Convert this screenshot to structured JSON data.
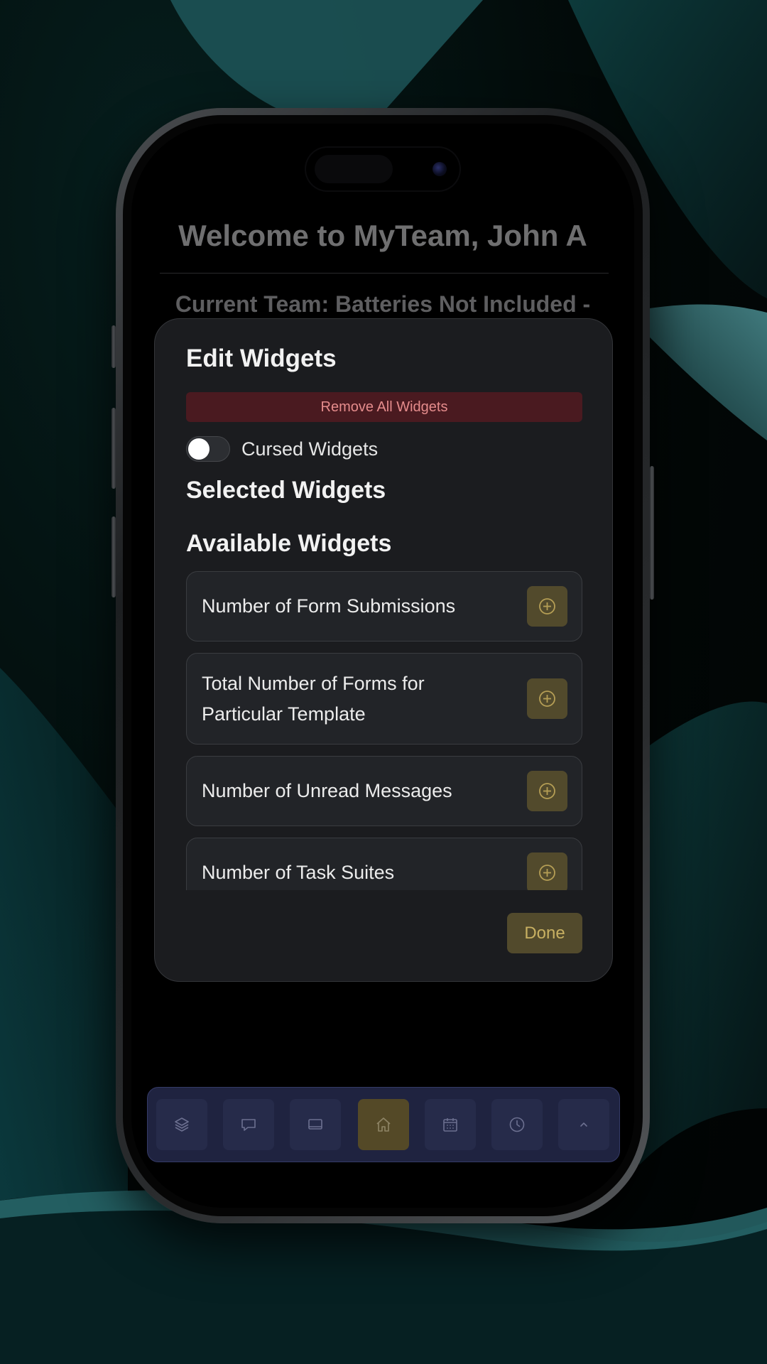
{
  "page": {
    "title": "Welcome to MyTeam, John A",
    "current_team": "Current Team: Batteries Not Included -"
  },
  "modal": {
    "title": "Edit Widgets",
    "remove_all_label": "Remove All Widgets",
    "cursed_toggle": {
      "label": "Cursed Widgets",
      "on": false
    },
    "selected_heading": "Selected Widgets",
    "available_heading": "Available Widgets",
    "available_widgets": [
      {
        "label": "Number of Form Submissions",
        "action_icon": "plus-circle-icon"
      },
      {
        "label": "Total Number of Forms for Particular Template",
        "action_icon": "plus-circle-icon"
      },
      {
        "label": "Number of Unread Messages",
        "action_icon": "plus-circle-icon"
      },
      {
        "label": "Number of Task Suites",
        "action_icon": "plus-circle-icon"
      }
    ],
    "done_label": "Done"
  },
  "nav": {
    "items": [
      {
        "icon": "layers-icon",
        "active": false
      },
      {
        "icon": "chat-icon",
        "active": false
      },
      {
        "icon": "tablet-icon",
        "active": false
      },
      {
        "icon": "home-icon",
        "active": true
      },
      {
        "icon": "calendar-icon",
        "active": false
      },
      {
        "icon": "clock-icon",
        "active": false
      },
      {
        "icon": "chevron-up-icon",
        "active": false
      }
    ]
  },
  "colors": {
    "accent": "#524a2c",
    "accent_text": "#c8b062",
    "danger_bg": "#4a1a20",
    "danger_text": "#e58c8c",
    "nav_bg": "#1f2340",
    "modal_bg": "#1b1c1f"
  }
}
